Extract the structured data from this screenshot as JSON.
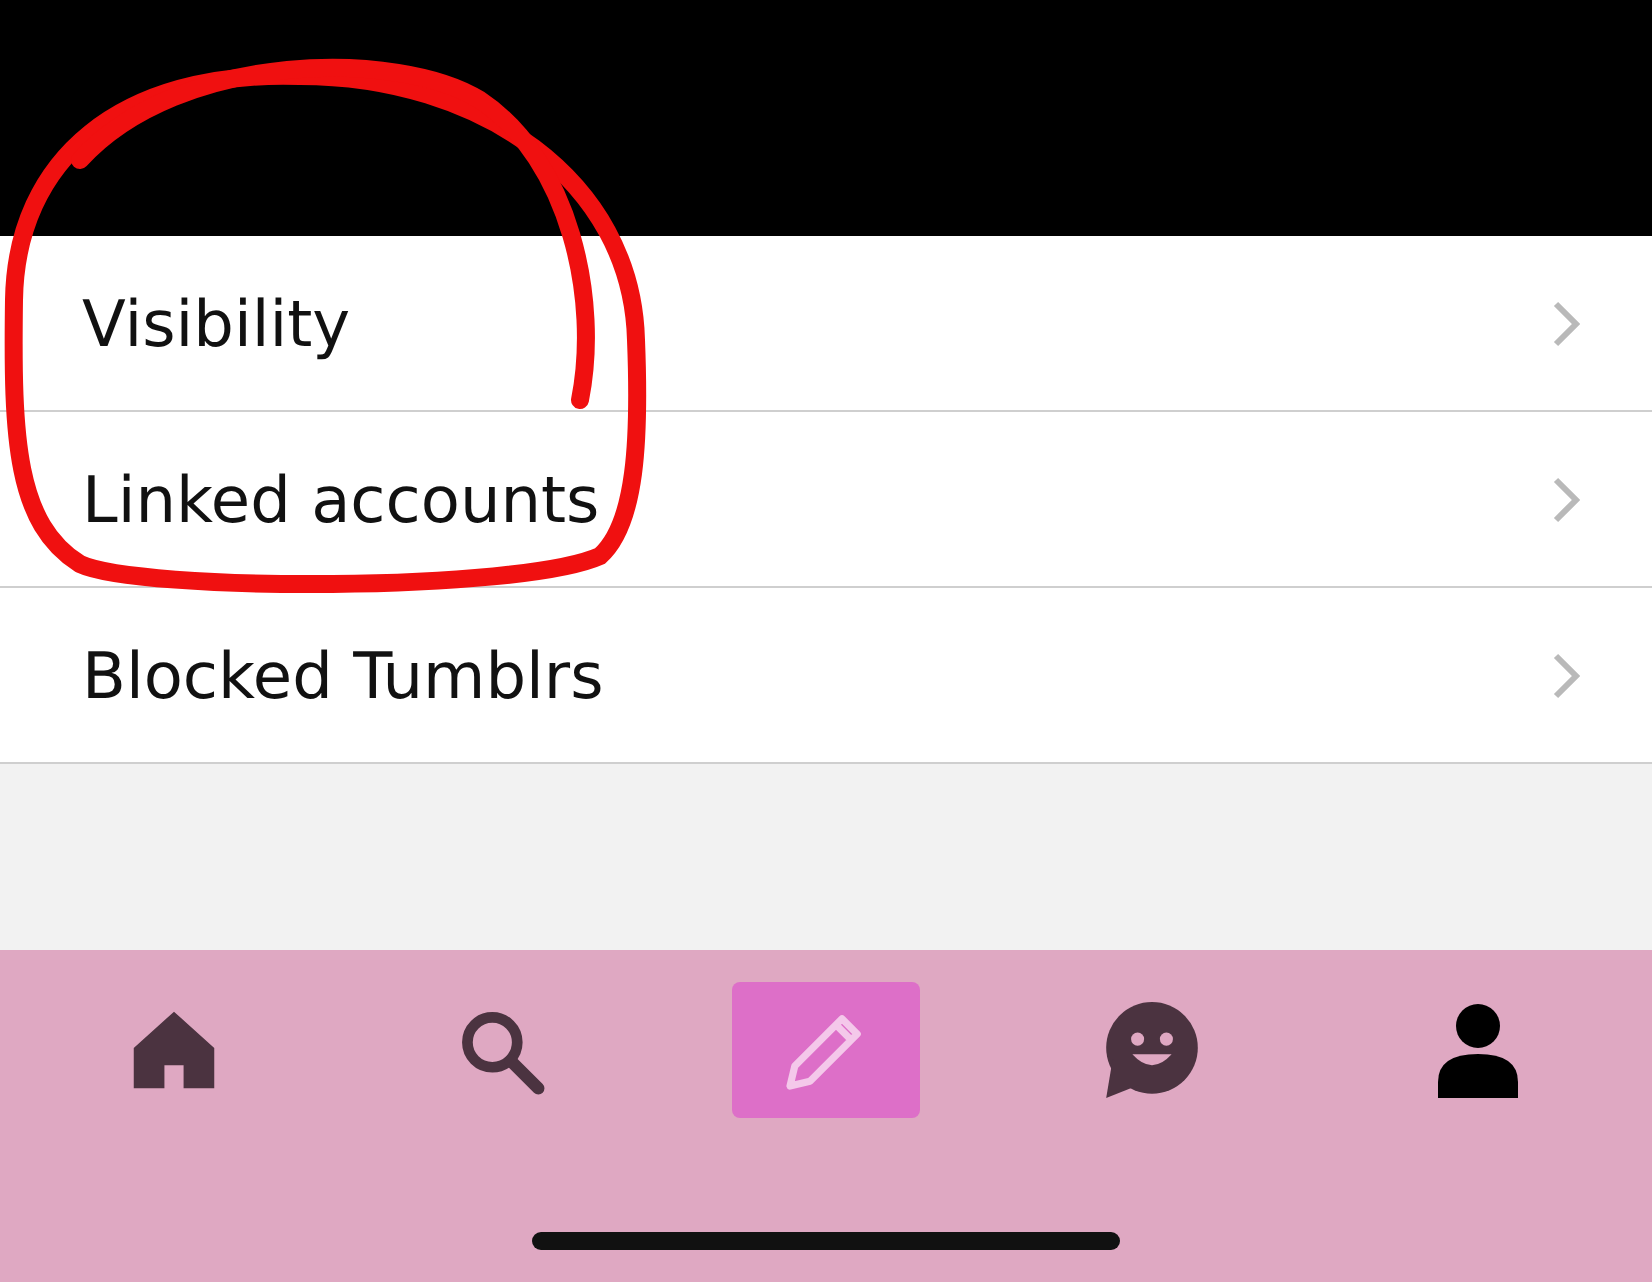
{
  "settings_rows": [
    {
      "label": "Visibility"
    },
    {
      "label": "Linked accounts"
    },
    {
      "label": "Blocked Tumblrs"
    }
  ],
  "tab_bar": [
    {
      "kind": "home",
      "selected": false
    },
    {
      "kind": "search",
      "selected": false
    },
    {
      "kind": "compose",
      "selected": false
    },
    {
      "kind": "chat",
      "selected": false
    },
    {
      "kind": "account",
      "selected": true
    }
  ],
  "annotation": {
    "kind": "circle"
  }
}
